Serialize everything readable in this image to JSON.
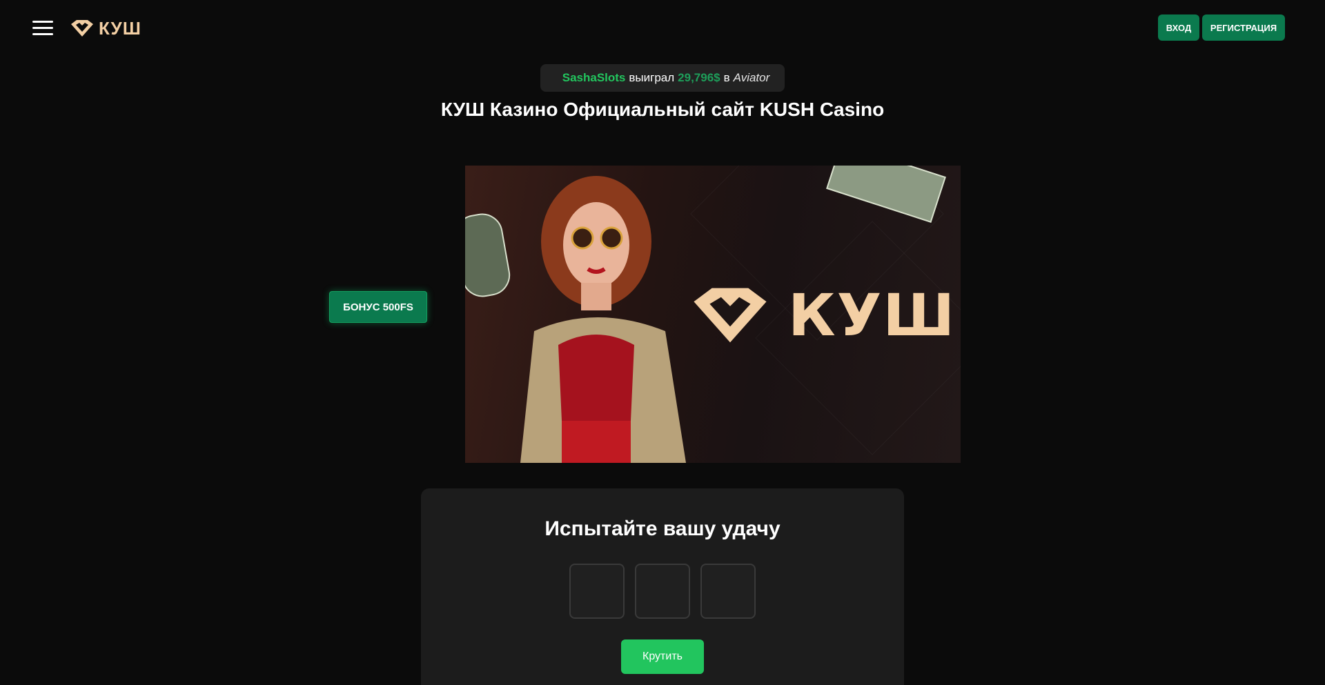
{
  "header": {
    "logo_text": "КУШ",
    "login_label": "ВХОД",
    "register_label": "РЕГИСТРАЦИЯ"
  },
  "ticker": {
    "icon_1": "",
    "icon_2": "",
    "user": "SashaSlots",
    "verb": "выиграл",
    "amount": "29,796$",
    "preposition": "в",
    "game": "Aviator"
  },
  "page_title": "КУШ Казино Официальный сайт KUSH Casino",
  "bonus_label": "БОНУС 500FS ",
  "banner": {
    "logo_text": "КУШ"
  },
  "game": {
    "title": " Испытайте вашу удачу",
    "reels": [
      "",
      "",
      ""
    ],
    "spin_label": " Крутить"
  },
  "colors": {
    "accent_green": "#0b7a4e",
    "bright_green": "#22c55e",
    "logo_gold": "#f3cfa4",
    "background": "#0b0b0b"
  }
}
